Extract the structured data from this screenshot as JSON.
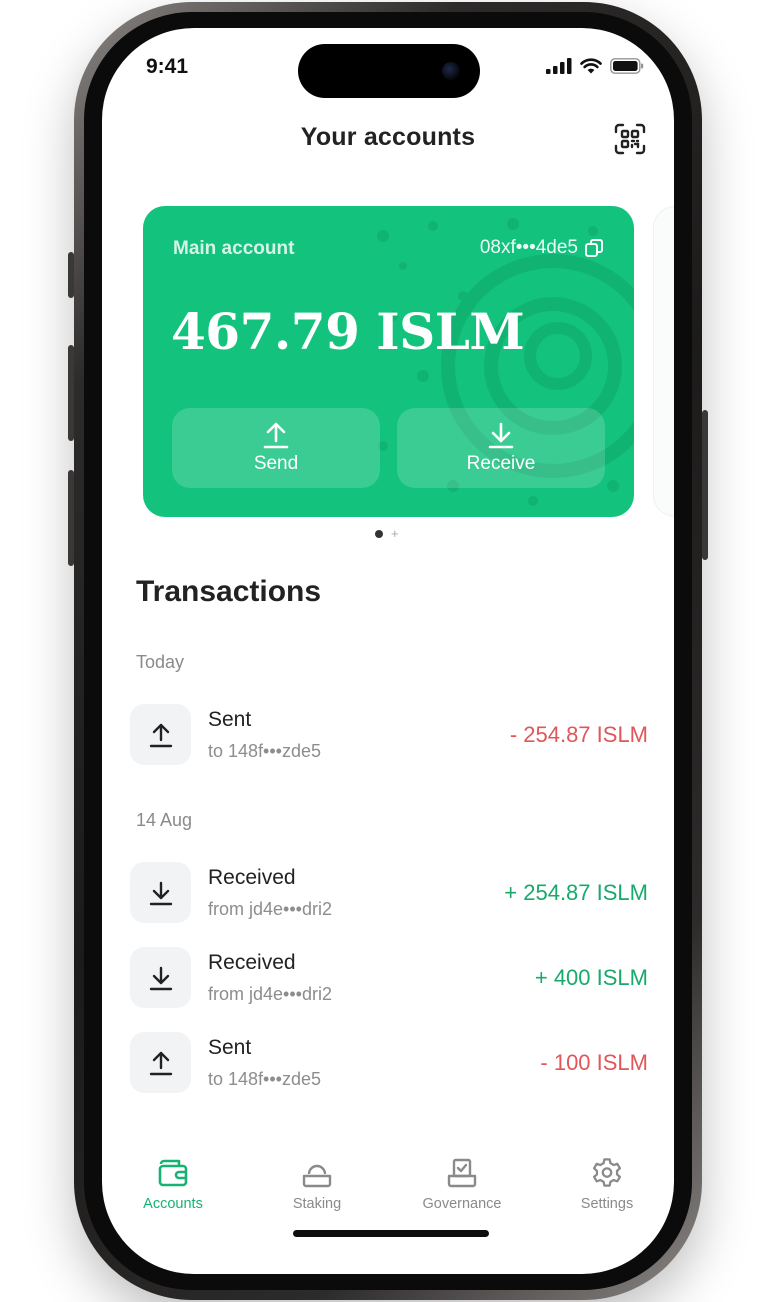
{
  "status_bar": {
    "time": "9:41"
  },
  "header": {
    "title": "Your accounts"
  },
  "card": {
    "name": "Main account",
    "address": "08xf•••4de5",
    "balance": "467.79 ISLM",
    "send_label": "Send",
    "receive_label": "Receive",
    "color": "#13c27c"
  },
  "transactions": {
    "title": "Transactions",
    "groups": [
      {
        "label": "Today",
        "items": [
          {
            "type": "sent",
            "title": "Sent",
            "sub": "to 148f•••zde5",
            "amount": "- 254.87 ISLM",
            "icon": "upload-icon"
          }
        ]
      },
      {
        "label": "14 Aug",
        "items": [
          {
            "type": "received",
            "title": "Received",
            "sub": "from jd4e•••dri2",
            "amount": "+ 254.87 ISLM",
            "icon": "download-icon"
          },
          {
            "type": "received",
            "title": "Received",
            "sub": "from jd4e•••dri2",
            "amount": "+ 400 ISLM",
            "icon": "download-icon"
          },
          {
            "type": "sent",
            "title": "Sent",
            "sub": "to 148f•••zde5",
            "amount": "- 100 ISLM",
            "icon": "upload-icon"
          }
        ]
      }
    ]
  },
  "tabs": [
    {
      "label": "Accounts",
      "icon": "wallet-icon",
      "active": true
    },
    {
      "label": "Staking",
      "icon": "staking-icon",
      "active": false
    },
    {
      "label": "Governance",
      "icon": "ballot-icon",
      "active": false
    },
    {
      "label": "Settings",
      "icon": "gear-icon",
      "active": false
    }
  ],
  "colors": {
    "accent": "#16b274",
    "negative": "#e0565a",
    "positive": "#18a96c"
  }
}
